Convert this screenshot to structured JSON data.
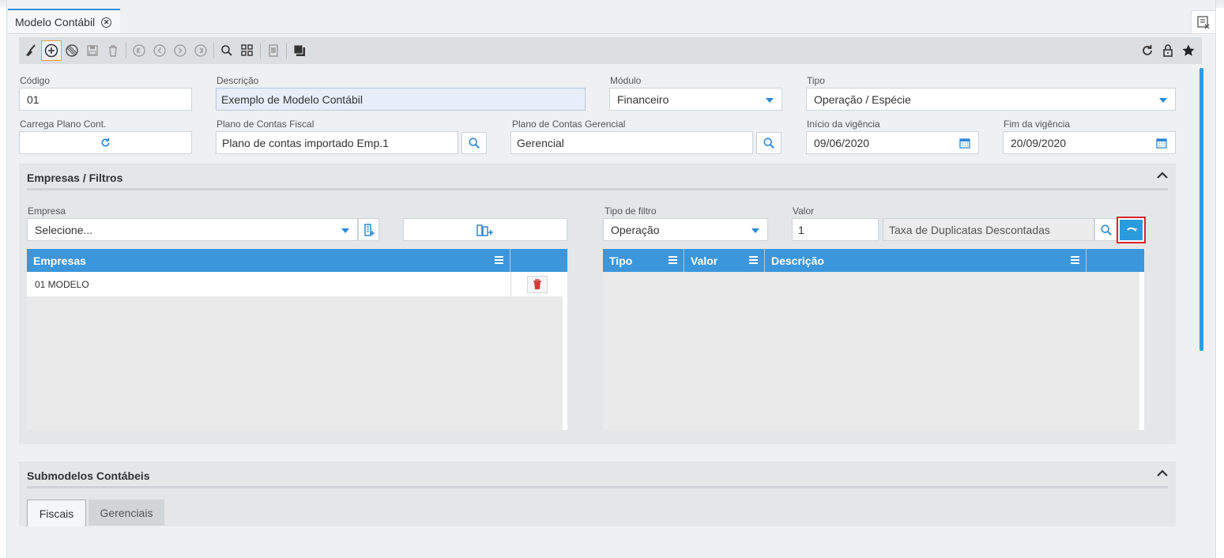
{
  "window": {
    "tab_title": "Modelo Contábil"
  },
  "toolbar": {
    "left_icons": [
      "broom-icon",
      "add-icon",
      "cancel-icon",
      "save-icon",
      "delete-icon",
      "first-icon",
      "previous-icon",
      "next-icon",
      "last-icon",
      "search-icon",
      "grid-icon",
      "print-icon",
      "copy-icon"
    ],
    "right_icons": [
      "refresh-icon",
      "lock-icon",
      "star-icon"
    ]
  },
  "form": {
    "codigo_label": "Código",
    "codigo_value": "01",
    "descricao_label": "Descrição",
    "descricao_value": "Exemplo de Modelo Contábil",
    "modulo_label": "Módulo",
    "modulo_value": "Financeiro",
    "tipo_label": "Tipo",
    "tipo_value": "Operação / Espécie",
    "carrega_label": "Carrega Plano Cont.",
    "plano_fiscal_label": "Plano de Contas Fiscal",
    "plano_fiscal_value": "Plano de contas importado Emp.1",
    "plano_gerencial_label": "Plano de Contas Gerencial",
    "plano_gerencial_value": "Gerencial",
    "inicio_label": "Início da vigência",
    "inicio_value": "09/06/2020",
    "fim_label": "Fim da vigência",
    "fim_value": "20/09/2020"
  },
  "empresas_panel": {
    "title": "Empresas / Filtros",
    "empresa_label": "Empresa",
    "empresa_placeholder": "Selecione...",
    "tipo_filtro_label": "Tipo de filtro",
    "tipo_filtro_value": "Operação",
    "valor_label": "Valor",
    "valor_value": "1",
    "valor_descricao": "Taxa de Duplicatas Descontadas",
    "empresas_grid": {
      "header": "Empresas",
      "rows": [
        {
          "empresa": "01 MODELO"
        }
      ]
    },
    "filtros_grid": {
      "headers": [
        "Tipo",
        "Valor",
        "Descrição"
      ]
    }
  },
  "submodelos_panel": {
    "title": "Submodelos Contábeis",
    "tabs": [
      "Fiscais",
      "Gerenciais"
    ],
    "active_tab": "Fiscais"
  },
  "colors": {
    "accent": "#3b96dc",
    "highlight_border": "#e0202a",
    "active_tool_border": "#e8a33a"
  }
}
